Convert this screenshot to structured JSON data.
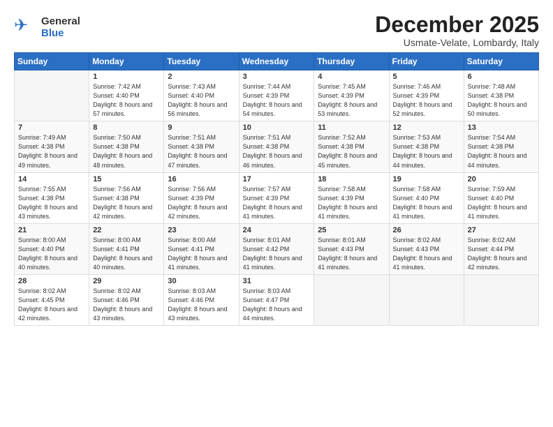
{
  "header": {
    "logo_general": "General",
    "logo_blue": "Blue",
    "title": "December 2025",
    "subtitle": "Usmate-Velate, Lombardy, Italy"
  },
  "calendar": {
    "days_of_week": [
      "Sunday",
      "Monday",
      "Tuesday",
      "Wednesday",
      "Thursday",
      "Friday",
      "Saturday"
    ],
    "weeks": [
      [
        {
          "day": "",
          "sunrise": "",
          "sunset": "",
          "daylight": ""
        },
        {
          "day": "1",
          "sunrise": "Sunrise: 7:42 AM",
          "sunset": "Sunset: 4:40 PM",
          "daylight": "Daylight: 8 hours and 57 minutes."
        },
        {
          "day": "2",
          "sunrise": "Sunrise: 7:43 AM",
          "sunset": "Sunset: 4:40 PM",
          "daylight": "Daylight: 8 hours and 56 minutes."
        },
        {
          "day": "3",
          "sunrise": "Sunrise: 7:44 AM",
          "sunset": "Sunset: 4:39 PM",
          "daylight": "Daylight: 8 hours and 54 minutes."
        },
        {
          "day": "4",
          "sunrise": "Sunrise: 7:45 AM",
          "sunset": "Sunset: 4:39 PM",
          "daylight": "Daylight: 8 hours and 53 minutes."
        },
        {
          "day": "5",
          "sunrise": "Sunrise: 7:46 AM",
          "sunset": "Sunset: 4:39 PM",
          "daylight": "Daylight: 8 hours and 52 minutes."
        },
        {
          "day": "6",
          "sunrise": "Sunrise: 7:48 AM",
          "sunset": "Sunset: 4:38 PM",
          "daylight": "Daylight: 8 hours and 50 minutes."
        }
      ],
      [
        {
          "day": "7",
          "sunrise": "Sunrise: 7:49 AM",
          "sunset": "Sunset: 4:38 PM",
          "daylight": "Daylight: 8 hours and 49 minutes."
        },
        {
          "day": "8",
          "sunrise": "Sunrise: 7:50 AM",
          "sunset": "Sunset: 4:38 PM",
          "daylight": "Daylight: 8 hours and 48 minutes."
        },
        {
          "day": "9",
          "sunrise": "Sunrise: 7:51 AM",
          "sunset": "Sunset: 4:38 PM",
          "daylight": "Daylight: 8 hours and 47 minutes."
        },
        {
          "day": "10",
          "sunrise": "Sunrise: 7:51 AM",
          "sunset": "Sunset: 4:38 PM",
          "daylight": "Daylight: 8 hours and 46 minutes."
        },
        {
          "day": "11",
          "sunrise": "Sunrise: 7:52 AM",
          "sunset": "Sunset: 4:38 PM",
          "daylight": "Daylight: 8 hours and 45 minutes."
        },
        {
          "day": "12",
          "sunrise": "Sunrise: 7:53 AM",
          "sunset": "Sunset: 4:38 PM",
          "daylight": "Daylight: 8 hours and 44 minutes."
        },
        {
          "day": "13",
          "sunrise": "Sunrise: 7:54 AM",
          "sunset": "Sunset: 4:38 PM",
          "daylight": "Daylight: 8 hours and 44 minutes."
        }
      ],
      [
        {
          "day": "14",
          "sunrise": "Sunrise: 7:55 AM",
          "sunset": "Sunset: 4:38 PM",
          "daylight": "Daylight: 8 hours and 43 minutes."
        },
        {
          "day": "15",
          "sunrise": "Sunrise: 7:56 AM",
          "sunset": "Sunset: 4:38 PM",
          "daylight": "Daylight: 8 hours and 42 minutes."
        },
        {
          "day": "16",
          "sunrise": "Sunrise: 7:56 AM",
          "sunset": "Sunset: 4:39 PM",
          "daylight": "Daylight: 8 hours and 42 minutes."
        },
        {
          "day": "17",
          "sunrise": "Sunrise: 7:57 AM",
          "sunset": "Sunset: 4:39 PM",
          "daylight": "Daylight: 8 hours and 41 minutes."
        },
        {
          "day": "18",
          "sunrise": "Sunrise: 7:58 AM",
          "sunset": "Sunset: 4:39 PM",
          "daylight": "Daylight: 8 hours and 41 minutes."
        },
        {
          "day": "19",
          "sunrise": "Sunrise: 7:58 AM",
          "sunset": "Sunset: 4:40 PM",
          "daylight": "Daylight: 8 hours and 41 minutes."
        },
        {
          "day": "20",
          "sunrise": "Sunrise: 7:59 AM",
          "sunset": "Sunset: 4:40 PM",
          "daylight": "Daylight: 8 hours and 41 minutes."
        }
      ],
      [
        {
          "day": "21",
          "sunrise": "Sunrise: 8:00 AM",
          "sunset": "Sunset: 4:40 PM",
          "daylight": "Daylight: 8 hours and 40 minutes."
        },
        {
          "day": "22",
          "sunrise": "Sunrise: 8:00 AM",
          "sunset": "Sunset: 4:41 PM",
          "daylight": "Daylight: 8 hours and 40 minutes."
        },
        {
          "day": "23",
          "sunrise": "Sunrise: 8:00 AM",
          "sunset": "Sunset: 4:41 PM",
          "daylight": "Daylight: 8 hours and 41 minutes."
        },
        {
          "day": "24",
          "sunrise": "Sunrise: 8:01 AM",
          "sunset": "Sunset: 4:42 PM",
          "daylight": "Daylight: 8 hours and 41 minutes."
        },
        {
          "day": "25",
          "sunrise": "Sunrise: 8:01 AM",
          "sunset": "Sunset: 4:43 PM",
          "daylight": "Daylight: 8 hours and 41 minutes."
        },
        {
          "day": "26",
          "sunrise": "Sunrise: 8:02 AM",
          "sunset": "Sunset: 4:43 PM",
          "daylight": "Daylight: 8 hours and 41 minutes."
        },
        {
          "day": "27",
          "sunrise": "Sunrise: 8:02 AM",
          "sunset": "Sunset: 4:44 PM",
          "daylight": "Daylight: 8 hours and 42 minutes."
        }
      ],
      [
        {
          "day": "28",
          "sunrise": "Sunrise: 8:02 AM",
          "sunset": "Sunset: 4:45 PM",
          "daylight": "Daylight: 8 hours and 42 minutes."
        },
        {
          "day": "29",
          "sunrise": "Sunrise: 8:02 AM",
          "sunset": "Sunset: 4:46 PM",
          "daylight": "Daylight: 8 hours and 43 minutes."
        },
        {
          "day": "30",
          "sunrise": "Sunrise: 8:03 AM",
          "sunset": "Sunset: 4:46 PM",
          "daylight": "Daylight: 8 hours and 43 minutes."
        },
        {
          "day": "31",
          "sunrise": "Sunrise: 8:03 AM",
          "sunset": "Sunset: 4:47 PM",
          "daylight": "Daylight: 8 hours and 44 minutes."
        },
        {
          "day": "",
          "sunrise": "",
          "sunset": "",
          "daylight": ""
        },
        {
          "day": "",
          "sunrise": "",
          "sunset": "",
          "daylight": ""
        },
        {
          "day": "",
          "sunrise": "",
          "sunset": "",
          "daylight": ""
        }
      ]
    ]
  }
}
